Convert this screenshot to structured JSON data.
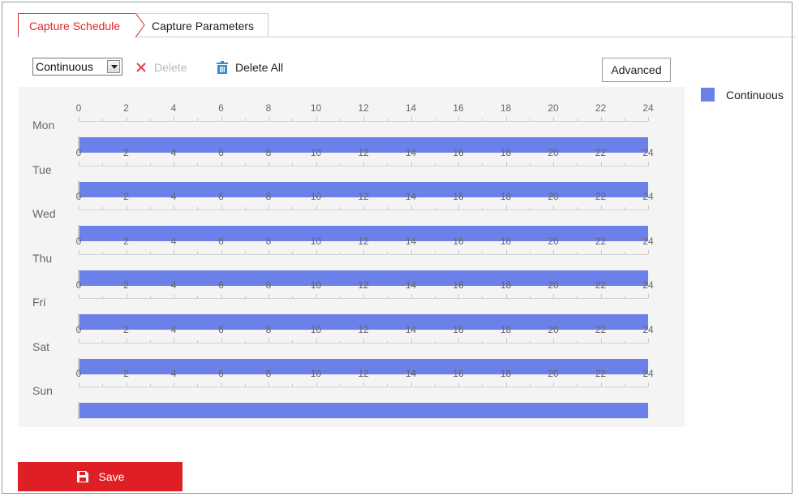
{
  "tabs": [
    {
      "label": "Capture Schedule",
      "active": true
    },
    {
      "label": "Capture Parameters",
      "active": false
    }
  ],
  "toolbar": {
    "mode_select": {
      "value": "Continuous"
    },
    "delete_label": "Delete",
    "delete_all_label": "Delete All",
    "advanced_label": "Advanced"
  },
  "legend": {
    "label": "Continuous",
    "color": "#6b80e8"
  },
  "schedule": {
    "tick_labels": [
      "0",
      "2",
      "4",
      "6",
      "8",
      "10",
      "12",
      "14",
      "16",
      "18",
      "20",
      "22",
      "24"
    ],
    "days": [
      {
        "name": "Mon",
        "segments": [
          {
            "start": 0,
            "end": 24,
            "type": "Continuous"
          }
        ]
      },
      {
        "name": "Tue",
        "segments": [
          {
            "start": 0,
            "end": 24,
            "type": "Continuous"
          }
        ]
      },
      {
        "name": "Wed",
        "segments": [
          {
            "start": 0,
            "end": 24,
            "type": "Continuous"
          }
        ]
      },
      {
        "name": "Thu",
        "segments": [
          {
            "start": 0,
            "end": 24,
            "type": "Continuous"
          }
        ]
      },
      {
        "name": "Fri",
        "segments": [
          {
            "start": 0,
            "end": 24,
            "type": "Continuous"
          }
        ]
      },
      {
        "name": "Sat",
        "segments": [
          {
            "start": 0,
            "end": 24,
            "type": "Continuous"
          }
        ]
      },
      {
        "name": "Sun",
        "segments": [
          {
            "start": 0,
            "end": 24,
            "type": "Continuous"
          }
        ]
      }
    ]
  },
  "save_label": "Save",
  "colors": {
    "accent": "#e0262b",
    "bar": "#6b80e8",
    "save_bg": "#df1f26"
  }
}
